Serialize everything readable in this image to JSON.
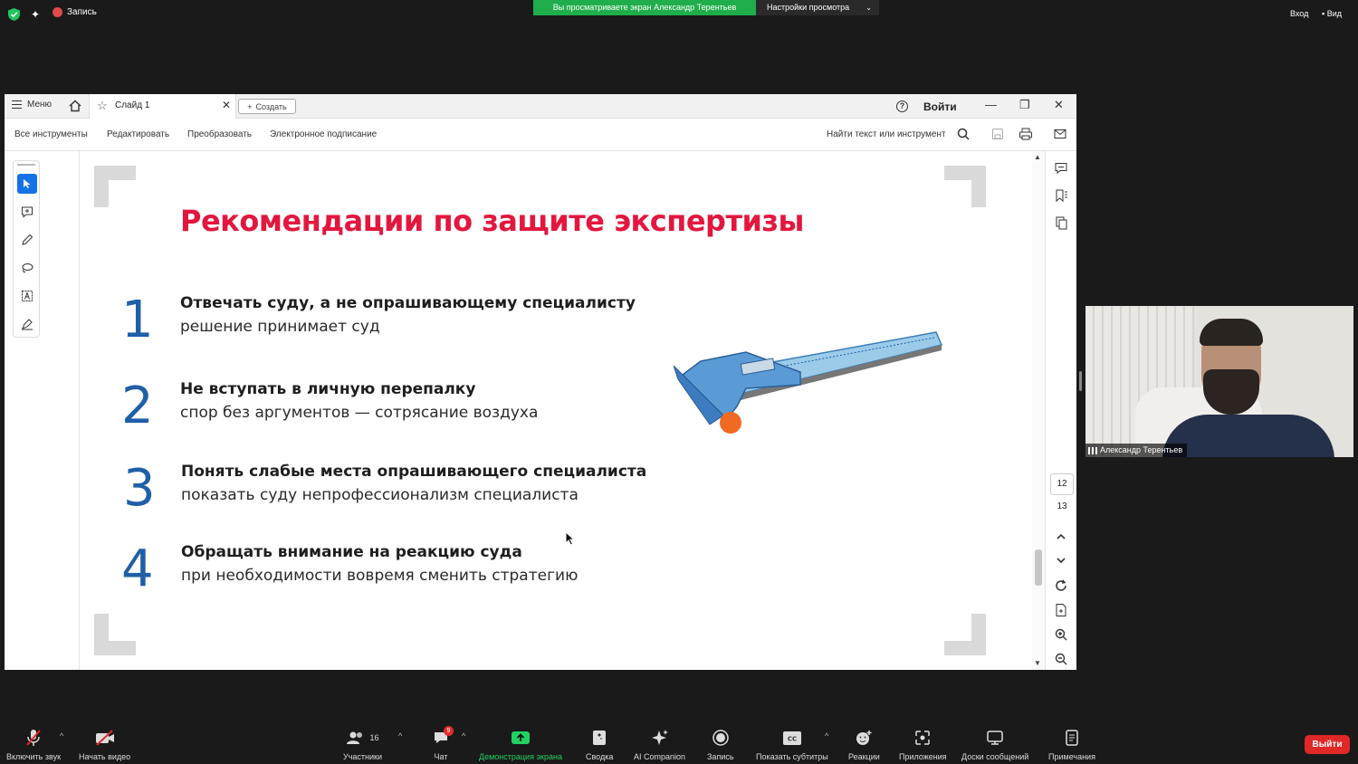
{
  "zoom_top": {
    "recording_label": "Запись",
    "sharing_banner": "Вы просматриваете экран Александр Терентьев",
    "view_options": "Настройки просмотра",
    "login": "Вход",
    "view": "Вид"
  },
  "acrobat": {
    "menu": "Меню",
    "tab_title": "Слайд 1",
    "create": "Создать",
    "sign_in": "Войти",
    "toolbar": {
      "all_tools": "Все инструменты",
      "edit": "Редактировать",
      "convert": "Преобразовать",
      "esign": "Электронное подписание",
      "find": "Найти текст или инструмент"
    },
    "page_current": "12",
    "page_total": "13"
  },
  "slide": {
    "title": "Рекомендации по защите экспертизы",
    "items": [
      {
        "num": "1",
        "head": "Отвечать суду, а не опрашивающему специалисту",
        "sub": "решение принимает суд"
      },
      {
        "num": "2",
        "head": "Не вступать в личную перепалку",
        "sub": "спор без аргументов — сотрясание воздуха"
      },
      {
        "num": "3",
        "head": "Понять слабые места опрашивающего специалиста",
        "sub": "показать суду непрофессионализм специалиста"
      },
      {
        "num": "4",
        "head": "Обращать внимание на реакцию суда",
        "sub": "при необходимости вовремя сменить стратегию"
      }
    ]
  },
  "participant": {
    "name": "Александр Терентьев"
  },
  "zoom_bottom": {
    "mute": "Включить звук",
    "video": "Начать видео",
    "participants": "Участники",
    "participants_count": "16",
    "chat": "Чат",
    "chat_badge": "9",
    "share": "Демонстрация экрана",
    "summary": "Сводка",
    "ai": "AI Companion",
    "record": "Запись",
    "captions": "Показать субтитры",
    "reactions": "Реакции",
    "apps": "Приложения",
    "whiteboards": "Доски сообщений",
    "notes": "Примечания",
    "leave": "Выйти"
  },
  "colors": {
    "title_red": "#e3173e",
    "number_blue": "#1f5fa8",
    "share_green": "#1fae4b",
    "leave_red": "#e02828",
    "tool_active": "#1473e6"
  }
}
